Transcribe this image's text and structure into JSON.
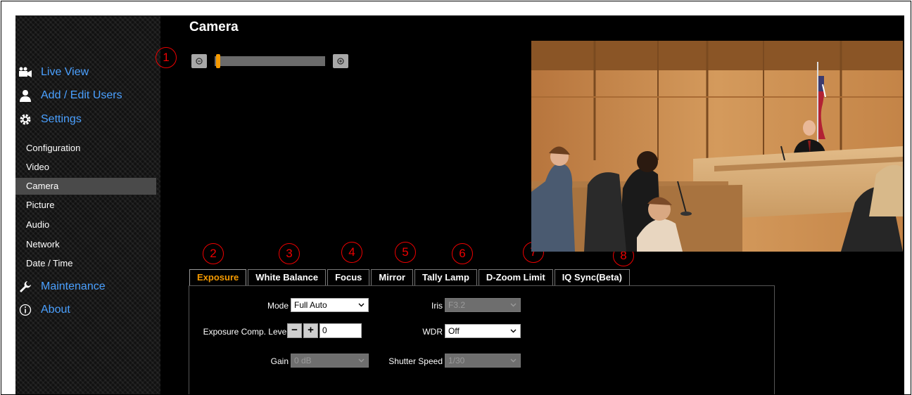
{
  "page": {
    "title": "Camera"
  },
  "sidebar": {
    "main": [
      {
        "label": "Live View",
        "icon": "video-camera-icon"
      },
      {
        "label": "Add / Edit Users",
        "icon": "user-icon"
      },
      {
        "label": "Settings",
        "icon": "gear-icon"
      },
      {
        "label": "Maintenance",
        "icon": "wrench-icon"
      },
      {
        "label": "About",
        "icon": "info-icon"
      }
    ],
    "sub": [
      "Configuration",
      "Video",
      "Camera",
      "Picture",
      "Audio",
      "Network",
      "Date / Time"
    ],
    "active_sub": "Camera"
  },
  "markers": [
    "1",
    "2",
    "3",
    "4",
    "5",
    "6",
    "7",
    "8"
  ],
  "zoom": {
    "level": 0.02
  },
  "tabs": [
    "Exposure",
    "White Balance",
    "Focus",
    "Mirror",
    "Tally Lamp",
    "D-Zoom Limit",
    "IQ Sync(Beta)"
  ],
  "active_tab": "Exposure",
  "exposure": {
    "mode_label": "Mode",
    "mode_value": "Full Auto",
    "comp_label": "Exposure Comp. Level",
    "comp_minus": "−",
    "comp_plus": "+",
    "comp_value": "0",
    "gain_label": "Gain",
    "gain_value": "0 dB",
    "iris_label": "Iris",
    "iris_value": "F3.2",
    "wdr_label": "WDR",
    "wdr_value": "Off",
    "shutter_label": "Shutter Speed",
    "shutter_value": "1/30"
  },
  "colors": {
    "accent": "#f59a00",
    "link": "#4aa0ff",
    "marker": "#e00000"
  }
}
